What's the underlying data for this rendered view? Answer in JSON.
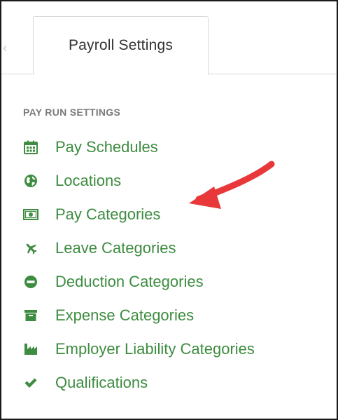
{
  "tab": {
    "prev_arrow": "‹",
    "label": "Payroll Settings"
  },
  "section": {
    "heading": "PAY RUN SETTINGS"
  },
  "menu": {
    "items": [
      {
        "label": "Pay Schedules",
        "icon": "calendar-icon"
      },
      {
        "label": "Locations",
        "icon": "globe-icon"
      },
      {
        "label": "Pay Categories",
        "icon": "money-icon"
      },
      {
        "label": "Leave Categories",
        "icon": "plane-icon"
      },
      {
        "label": "Deduction Categories",
        "icon": "minus-circle-icon"
      },
      {
        "label": "Expense Categories",
        "icon": "archive-icon"
      },
      {
        "label": "Employer Liability Categories",
        "icon": "industry-icon"
      },
      {
        "label": "Qualifications",
        "icon": "check-icon"
      }
    ]
  },
  "colors": {
    "link_green": "#3d8c40",
    "heading_gray": "#7a7a7a",
    "annotation_red": "#e8383a"
  }
}
